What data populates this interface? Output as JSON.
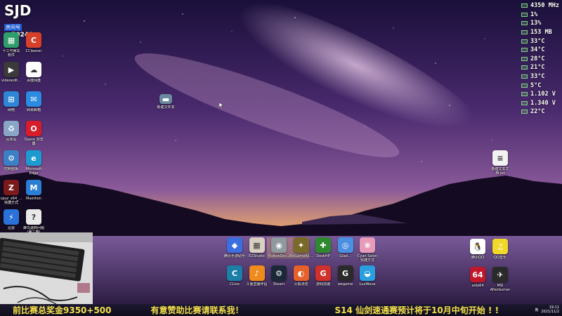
{
  "stream": {
    "logo_text": "SJD",
    "room_label": "房间号",
    "room_number": "70249"
  },
  "hardware_monitor": [
    {
      "value": "4350 MHz"
    },
    {
      "value": "1%"
    },
    {
      "value": "13%"
    },
    {
      "value": "153 MB"
    },
    {
      "value": "33°C"
    },
    {
      "value": "34°C"
    },
    {
      "value": "28°C"
    },
    {
      "value": "21°C"
    },
    {
      "value": "33°C"
    },
    {
      "value": "5°C"
    },
    {
      "value": "1.102 V"
    },
    {
      "value": "1.340 V"
    },
    {
      "value": "22°C"
    }
  ],
  "desktop_icons_left": [
    {
      "label": "十三号赛车\n软件",
      "icon": "app-icon",
      "color": "#2f9e6a",
      "glyph": "▦"
    },
    {
      "label": "CCleaner",
      "icon": "ccleaner-icon",
      "color": "#d6402b",
      "glyph": "C"
    },
    {
      "label": "videoedit...",
      "icon": "video-editor-icon",
      "color": "#3a3a3a",
      "glyph": "▶"
    },
    {
      "label": "百度网盘",
      "icon": "baidu-netdisk-icon",
      "color": "#ffffff",
      "glyph": "☁"
    },
    {
      "label": "网络",
      "icon": "network-icon",
      "color": "#2d86d6",
      "glyph": "⊞"
    },
    {
      "label": "网易邮箱",
      "icon": "mail-icon",
      "color": "#2a8be0",
      "glyph": "✉"
    },
    {
      "label": "回收站",
      "icon": "recycle-bin-icon",
      "color": "#8aa6c6",
      "glyph": "♻"
    },
    {
      "label": "Opera 浏览\n器",
      "icon": "opera-icon",
      "color": "#d81d2a",
      "glyph": "O"
    },
    {
      "label": "控制面板",
      "icon": "control-panel-icon",
      "color": "#3b7fc4",
      "glyph": "⚙"
    },
    {
      "label": "Microsoft\nEdge",
      "icon": "edge-icon",
      "color": "#1d9bd1",
      "glyph": "e"
    },
    {
      "label": "cpuz_x64_...\n快捷方式",
      "icon": "cpuz-icon",
      "color": "#7a1a1a",
      "glyph": "Z"
    },
    {
      "label": "Maxthon",
      "icon": "maxthon-icon",
      "color": "#2a7fd4",
      "glyph": "M"
    },
    {
      "label": "迅雷",
      "icon": "thunder-icon",
      "color": "#2a72d8",
      "glyph": "⚡"
    },
    {
      "label": "蜂鸟遇到问题\n(第三期)",
      "icon": "help-file-icon",
      "color": "#e9e9e9",
      "glyph": "?"
    }
  ],
  "desktop_icons_middle": [
    {
      "label": "腾讯手游助手",
      "icon": "tencent-gaming-icon",
      "color": "#3b6fe0",
      "glyph": "◆"
    },
    {
      "label": "EZStudio",
      "icon": "ezstudio-icon",
      "color": "#d9d0c2",
      "glyph": "▦"
    },
    {
      "label": "YodlewDev...",
      "icon": "alien-icon",
      "color": "#8f9aa0",
      "glyph": "◉"
    },
    {
      "label": "WeGameRo...",
      "icon": "wegame-ro-icon",
      "color": "#7a6a2a",
      "glyph": "✦"
    },
    {
      "label": "DeskHP",
      "icon": "deskhp-icon",
      "color": "#2f8a2f",
      "glyph": "✚"
    },
    {
      "label": "Glad...",
      "icon": "glad-icon",
      "color": "#4a8fe0",
      "glyph": "◎"
    },
    {
      "label": "Cyan Salon\n快捷方式",
      "icon": "anime-app-icon",
      "color": "#e89ab9",
      "glyph": "❀"
    },
    {
      "label": "CLive",
      "icon": "clive-icon",
      "color": "#1b7fa8",
      "glyph": "C"
    },
    {
      "label": "斗鱼直播伴侣",
      "icon": "douyu-icon",
      "color": "#f08a1d",
      "glyph": "♪"
    },
    {
      "label": "Steam",
      "icon": "steam-icon",
      "color": "#1b2838",
      "glyph": "⚙"
    },
    {
      "label": "火狐浏览",
      "icon": "firefox-icon",
      "color": "#e6602a",
      "glyph": "◐"
    },
    {
      "label": "游戏加速",
      "icon": "game-booster-icon",
      "color": "#d2302a",
      "glyph": "G"
    },
    {
      "label": "wegame",
      "icon": "wegame-icon",
      "color": "#2a2a2a",
      "glyph": "G"
    },
    {
      "label": "LuxWave",
      "icon": "luxwave-icon",
      "color": "#2a9fe0",
      "glyph": "◒"
    }
  ],
  "desktop_icons_right": [
    {
      "label": "新建文本文\n档.txt",
      "icon": "text-file-icon",
      "color": "#f2f2f2",
      "glyph": "≡"
    },
    {
      "label": "腾讯QQ",
      "icon": "qq-icon",
      "color": "#ffffff",
      "glyph": "🐧"
    },
    {
      "label": "QQ音乐",
      "icon": "qq-music-icon",
      "color": "#f0d92a",
      "glyph": "♫"
    },
    {
      "label": "aida64",
      "icon": "aida64-icon",
      "color": "#c2172a",
      "glyph": "64"
    },
    {
      "label": "MSI\nAfterburner",
      "icon": "msi-afterburner-icon",
      "color": "#2a2a2a",
      "glyph": "✈"
    }
  ],
  "desktop_file_center": {
    "label": "新建文件夹",
    "icon": "folder-shortcut-icon"
  },
  "ticker": {
    "left_text": "前比赛总奖金9350+500",
    "mid_text": "有意赞助比赛请联系我！",
    "right_text": "S14 仙剑速通赛预计将于10月中旬开始 ! !"
  },
  "tray": {
    "time": "19:11",
    "date": "2021/11/2",
    "lang": "英"
  }
}
